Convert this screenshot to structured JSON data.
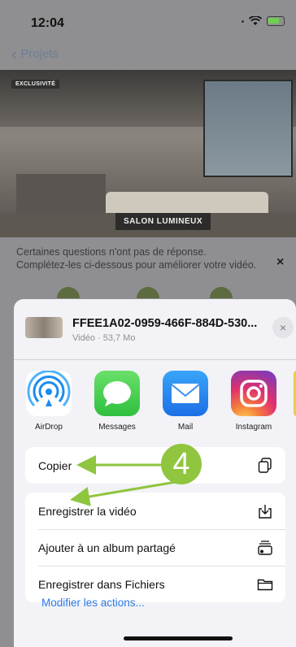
{
  "status_bar": {
    "time": "12:04"
  },
  "nav": {
    "back_label": "Projets"
  },
  "hero": {
    "badge": "EXCLUSIVITÉ",
    "room_label": "SALON LUMINEUX"
  },
  "prompt": {
    "text": "Certaines questions n'ont pas de réponse. Complétez-les ci-dessous pour améliorer votre vidéo.",
    "close_glyph": "×"
  },
  "share_sheet": {
    "file": {
      "name": "FFEE1A02-0959-466F-884D-530...",
      "meta": "Vidéo · 53,7 Mo",
      "close_glyph": "×"
    },
    "apps": [
      {
        "label": "AirDrop",
        "icon": "airdrop-icon"
      },
      {
        "label": "Messages",
        "icon": "messages-icon"
      },
      {
        "label": "Mail",
        "icon": "mail-icon"
      },
      {
        "label": "Instagram",
        "icon": "instagram-icon"
      }
    ],
    "actions_group_1": [
      {
        "label": "Copier",
        "icon": "copy-icon"
      }
    ],
    "actions_group_2": [
      {
        "label": "Enregistrer la vidéo",
        "icon": "save-download-icon"
      },
      {
        "label": "Ajouter à un album partagé",
        "icon": "shared-album-icon"
      },
      {
        "label": "Enregistrer dans Fichiers",
        "icon": "folder-icon"
      }
    ],
    "modify_actions": "Modifier les actions..."
  },
  "annotation": {
    "step_number": "4",
    "arrow_color": "#8fc53f"
  }
}
